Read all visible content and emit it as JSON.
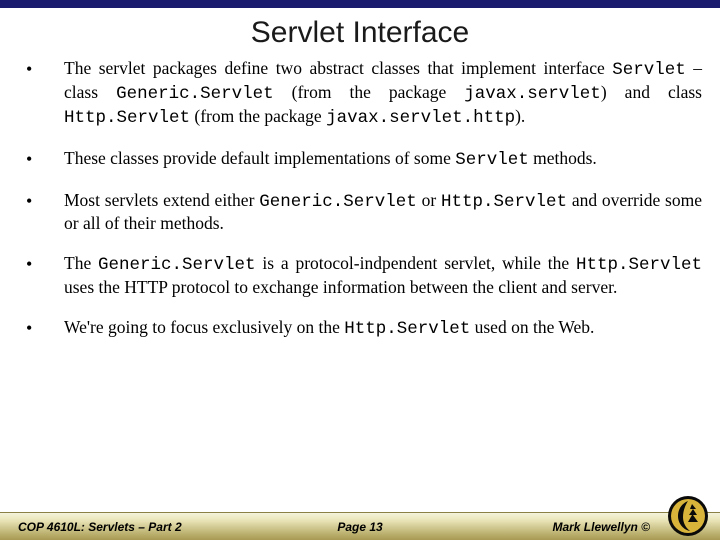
{
  "title": "Servlet Interface",
  "bullets": [
    {
      "segments": [
        {
          "t": "The servlet packages define two abstract classes that implement interface "
        },
        {
          "t": "Servlet",
          "mono": true
        },
        {
          "t": " – class "
        },
        {
          "t": "Generic.Servlet",
          "mono": true
        },
        {
          "t": " (from the package "
        },
        {
          "t": "javax.servlet",
          "mono": true
        },
        {
          "t": ") and class "
        },
        {
          "t": "Http.Servlet",
          "mono": true
        },
        {
          "t": " (from the package "
        },
        {
          "t": "javax.servlet.http",
          "mono": true
        },
        {
          "t": ")."
        }
      ]
    },
    {
      "segments": [
        {
          "t": "These classes provide default implementations of some "
        },
        {
          "t": "Servlet",
          "mono": true
        },
        {
          "t": " methods."
        }
      ]
    },
    {
      "segments": [
        {
          "t": "Most servlets extend either "
        },
        {
          "t": "Generic.Servlet",
          "mono": true
        },
        {
          "t": " or "
        },
        {
          "t": "Http.Servlet",
          "mono": true
        },
        {
          "t": " and override some or all of their methods."
        }
      ]
    },
    {
      "segments": [
        {
          "t": "The "
        },
        {
          "t": "Generic.Servlet",
          "mono": true
        },
        {
          "t": " is a protocol-indpendent servlet, while the "
        },
        {
          "t": "Http.Servlet",
          "mono": true
        },
        {
          "t": " uses the HTTP protocol to exchange information between the client and server."
        }
      ]
    },
    {
      "segments": [
        {
          "t": "We're going to focus exclusively on the "
        },
        {
          "t": "Http.Servlet",
          "mono": true
        },
        {
          "t": " used on the Web."
        }
      ]
    }
  ],
  "footer": {
    "course": "COP 4610L: Servlets – Part 2",
    "page": "Page 13",
    "author": "Mark Llewellyn ©"
  }
}
